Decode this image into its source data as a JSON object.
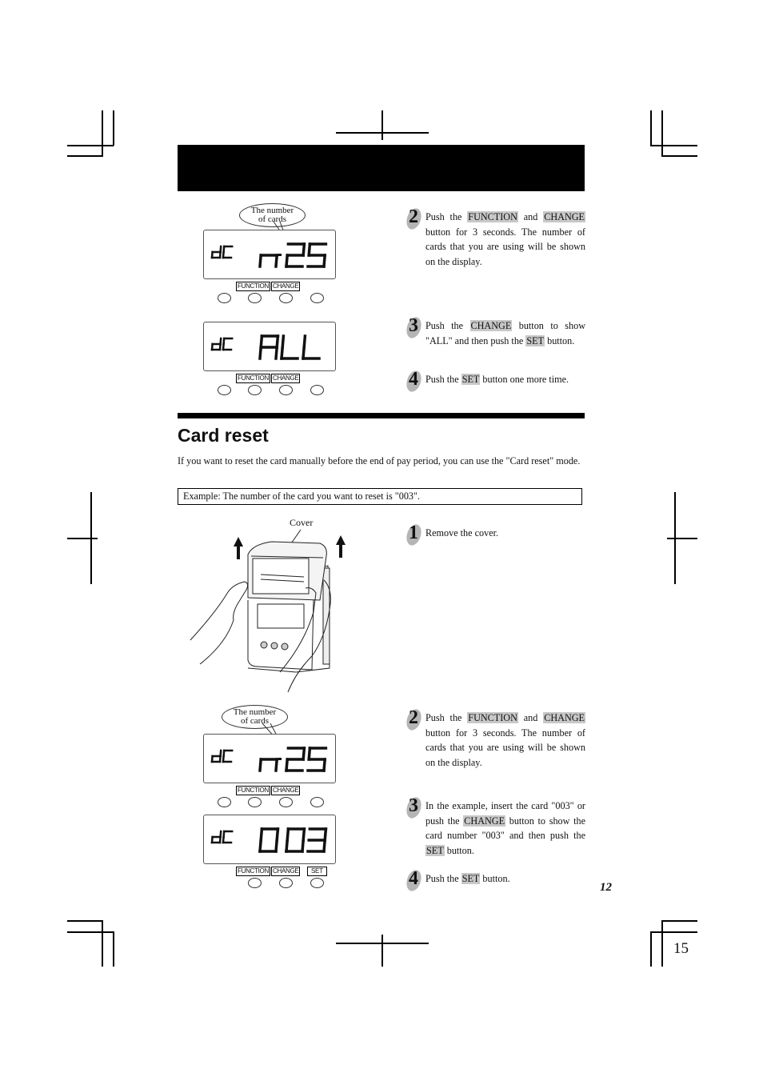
{
  "page": {
    "section_title": "Card reset",
    "intro_text": "If you want to reset the card manually before the end of pay period, you can use the \"Card reset\" mode.",
    "example_text": "Example: The number of the card you want to reset is \"003\".",
    "footer_page_label": "12",
    "sheet_number": "15"
  },
  "figures": {
    "bubble_text_line1": "The number",
    "bubble_text_line2": "of cards",
    "cover_label": "Cover",
    "button_labels": {
      "function": "FUNCTION",
      "change": "CHANGE",
      "set": "SET"
    },
    "displays": [
      {
        "mode": "dC",
        "value": "n-25"
      },
      {
        "mode": "dC",
        "value": "ALL"
      },
      {
        "mode": "dC",
        "value": "n-25"
      },
      {
        "mode": "dC",
        "value": "0 03"
      }
    ]
  },
  "top_steps": [
    {
      "number": "2",
      "parts": [
        "Push the ",
        "FUNCTION",
        " and ",
        "CHANGE",
        " button for 3 seconds. The number of cards that you are using will be shown on the display."
      ]
    },
    {
      "number": "3",
      "parts": [
        "Push the ",
        "CHANGE",
        " button to show \"ALL\" and then push the ",
        "SET",
        " button."
      ]
    },
    {
      "number": "4",
      "parts": [
        "Push the ",
        "SET",
        " button one more time."
      ]
    }
  ],
  "reset_steps": [
    {
      "number": "1",
      "parts": [
        "Remove the cover."
      ]
    },
    {
      "number": "2",
      "parts": [
        "Push the ",
        "FUNCTION",
        " and ",
        "CHANGE",
        " button for 3 seconds.  The number of cards that you are using will be shown on the display."
      ]
    },
    {
      "number": "3",
      "parts": [
        "In the example, insert the card \"003\" or push the ",
        "CHANGE",
        " button to show the card number \"003\" and then push the ",
        "SET",
        " button."
      ]
    },
    {
      "number": "4",
      "parts": [
        "Push the ",
        "SET",
        " button."
      ]
    }
  ]
}
